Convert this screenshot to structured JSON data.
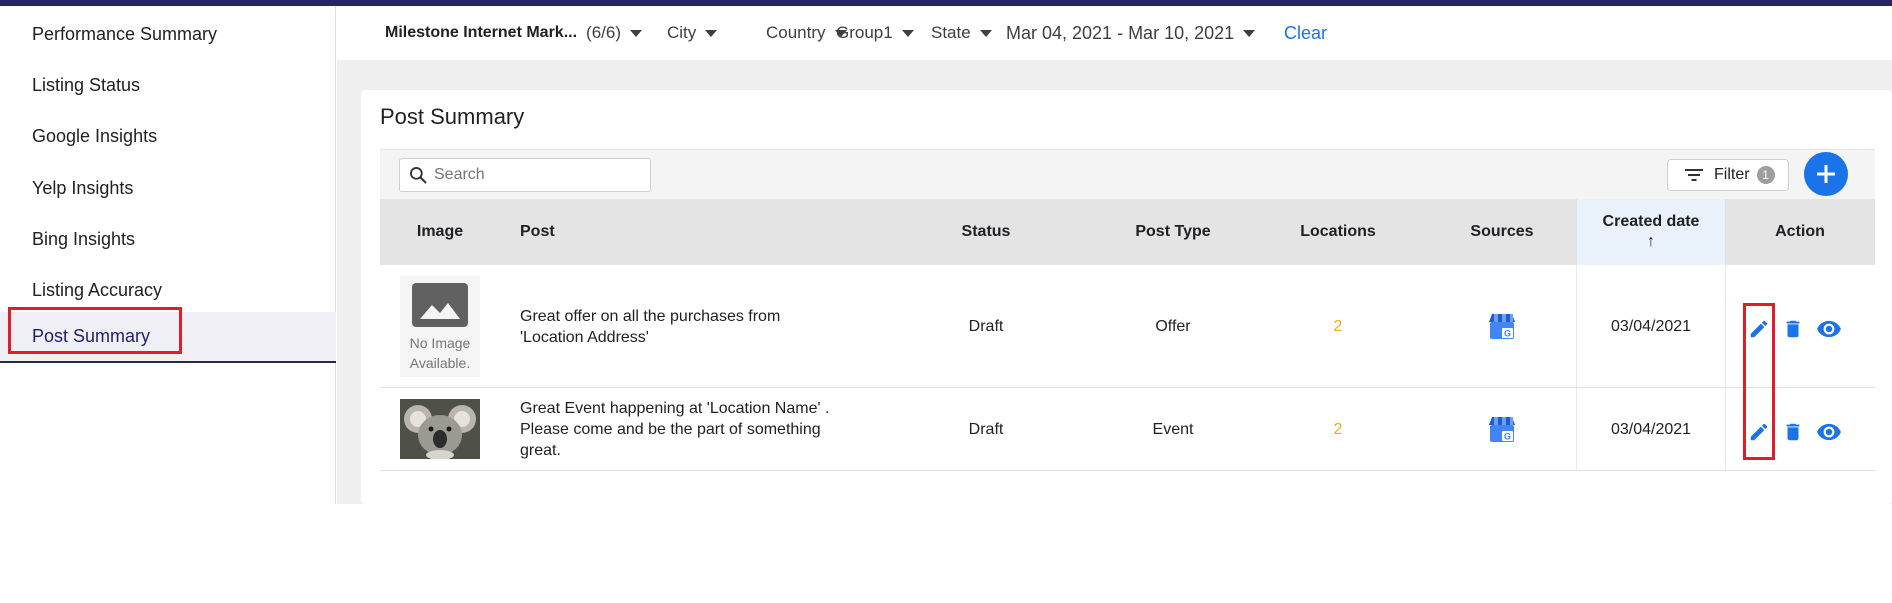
{
  "sidebar": {
    "items": [
      {
        "label": "Performance Summary"
      },
      {
        "label": "Listing Status"
      },
      {
        "label": "Google Insights"
      },
      {
        "label": "Yelp Insights"
      },
      {
        "label": "Bing Insights"
      },
      {
        "label": "Listing Accuracy"
      },
      {
        "label": "Post Summary",
        "active": true
      }
    ]
  },
  "filters": {
    "account": "Milestone Internet Mark...",
    "account_count": "(6/6)",
    "city": "City",
    "country": "Country",
    "group": "Group1",
    "state": "State",
    "date_range": "Mar 04, 2021 - Mar 10, 2021",
    "clear": "Clear"
  },
  "page": {
    "title": "Post Summary",
    "search_placeholder": "Search",
    "filter_label": "Filter",
    "filter_count": "1"
  },
  "table": {
    "headers": {
      "image": "Image",
      "post": "Post",
      "status": "Status",
      "post_type": "Post Type",
      "locations": "Locations",
      "sources": "Sources",
      "created_date": "Created date",
      "action": "Action"
    },
    "rows": [
      {
        "image": "no-image-placeholder",
        "no_image_text_1": "No Image",
        "no_image_text_2": "Available.",
        "post_line1": "Great offer on all the purchases from",
        "post_line2": "'Location Address'",
        "post_line3": "",
        "status": "Draft",
        "post_type": "Offer",
        "locations": "2",
        "source": "google-my-business-icon",
        "created_date": "03/04/2021"
      },
      {
        "image": "koala-photo",
        "post_line1": "Great Event happening at 'Location Name' .",
        "post_line2": "Please come and be the part of something",
        "post_line3": "great.",
        "status": "Draft",
        "post_type": "Event",
        "locations": "2",
        "source": "google-my-business-icon",
        "created_date": "03/04/2021"
      }
    ]
  },
  "colors": {
    "accent_blue": "#1a73e8",
    "highlight_red": "#e01e2b",
    "locations_orange": "#f4a51c",
    "nav_dark": "#26265e"
  },
  "icons": [
    "search-icon",
    "filter-icon",
    "plus-icon",
    "edit-icon",
    "delete-icon",
    "view-icon",
    "google-my-business-icon",
    "image-placeholder-icon"
  ]
}
